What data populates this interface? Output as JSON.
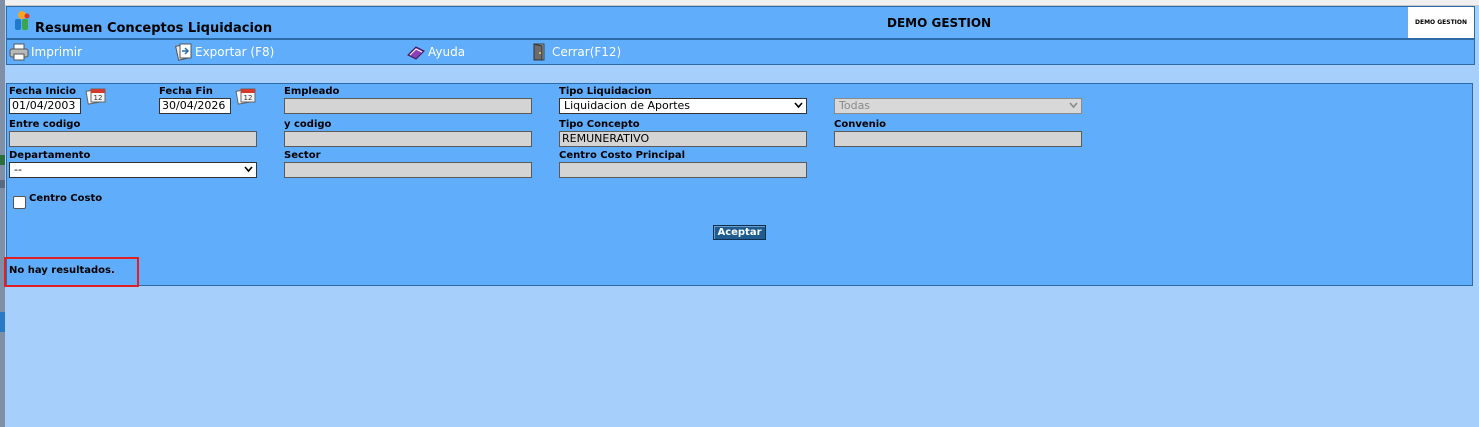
{
  "header": {
    "title": "Resumen Conceptos Liquidacion",
    "company": "DEMO GESTION",
    "brand_box": "DEMO GESTION"
  },
  "toolbar": {
    "print_label": "Imprimir",
    "export_label": "Exportar (F8)",
    "help_label": "Ayuda",
    "close_label": "Cerrar(F12)"
  },
  "form": {
    "fecha_inicio_label": "Fecha Inicio",
    "fecha_inicio_value": "01/04/2003",
    "fecha_fin_label": "Fecha Fin",
    "fecha_fin_value": "30/04/2026",
    "empleado_label": "Empleado",
    "empleado_value": "",
    "tipo_liquidacion_label": "Tipo Liquidacion",
    "tipo_liquidacion_value": "Liquidacion de Aportes",
    "todas_value": "Todas",
    "entre_codigo_label": "Entre codigo",
    "entre_codigo_value": "",
    "y_codigo_label": "y codigo",
    "y_codigo_value": "",
    "tipo_concepto_label": "Tipo Concepto",
    "tipo_concepto_value": "REMUNERATIVO",
    "convenio_label": "Convenio",
    "convenio_value": "",
    "departamento_label": "Departamento",
    "departamento_value": "--",
    "sector_label": "Sector",
    "sector_value": "",
    "centro_costo_principal_label": "Centro Costo Principal",
    "centro_costo_principal_value": "",
    "centro_costo_checkbox_label": "Centro Costo",
    "accept_label": "Aceptar"
  },
  "results": {
    "message": "No hay resultados."
  },
  "icons": {
    "app_logo": "app-logo-icon",
    "print": "printer-icon",
    "export": "export-icon",
    "help": "help-book-icon",
    "close": "door-icon",
    "calendar": "calendar-icon"
  },
  "colors": {
    "page_bg": "#a6d0fb",
    "panel_bg": "#5fadfb",
    "accept_bg": "#1f5c8f",
    "highlight": "#e31f26"
  }
}
